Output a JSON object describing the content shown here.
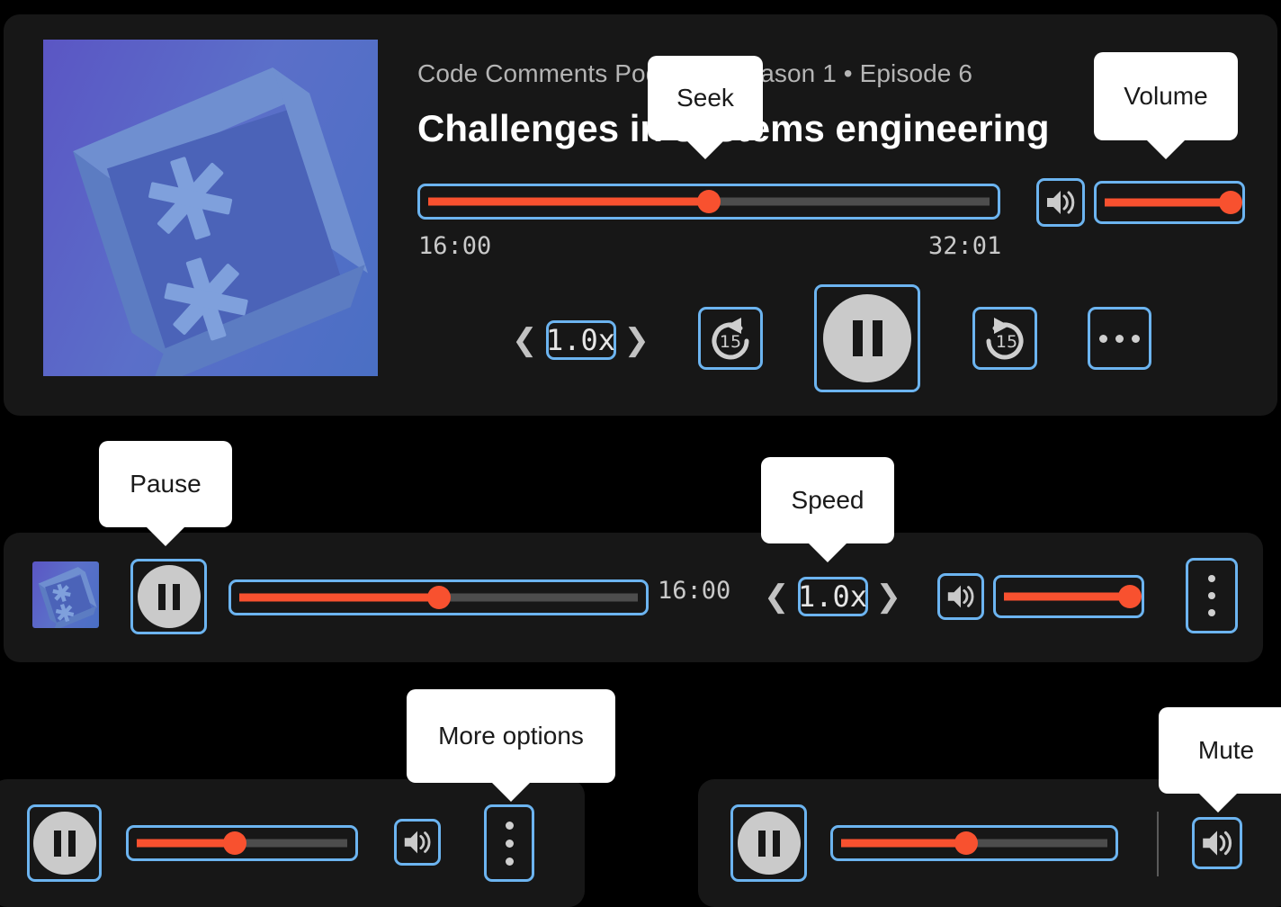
{
  "player": {
    "podcast_meta": "Code Comments Podcast • Season 1 • Episode 6",
    "episode_title": "Challenges in systems engineering",
    "current_time": "16:00",
    "total_time": "32:01",
    "seek_percent": 50,
    "volume_percent": 100,
    "speed_value": "1.0x",
    "skip_back_label": "15",
    "skip_forward_label": "15",
    "artwork_name": "code-comments-podcast-artwork"
  },
  "compact_bar": {
    "current_time": "16:00",
    "seek_percent": 50,
    "volume_percent": 100,
    "speed_value": "1.0x"
  },
  "mini_bar_left": {
    "seek_percent": 47
  },
  "mini_bar_right": {
    "seek_percent": 47
  },
  "tooltips": {
    "seek": "Seek",
    "volume": "Volume",
    "pause": "Pause",
    "speed": "Speed",
    "more_options": "More options",
    "mute": "Mute"
  },
  "icons": {
    "speaker": "speaker-icon",
    "pause": "pause-icon",
    "skip_back": "skip-back-15-icon",
    "skip_forward": "skip-forward-15-icon",
    "more_horizontal": "more-horizontal-icon",
    "more_vertical": "more-vertical-icon",
    "chevron_left": "chevron-left-icon",
    "chevron_right": "chevron-right-icon"
  },
  "colors": {
    "accent": "#f8512f",
    "focus_ring": "#6cb4f0",
    "panel": "#171717",
    "track": "#4d4d4d",
    "disc": "#cacaca"
  }
}
